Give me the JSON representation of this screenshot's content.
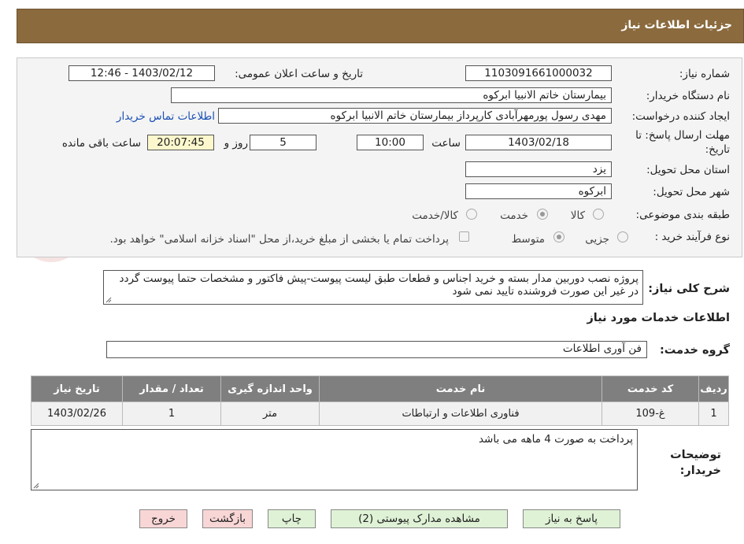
{
  "header": {
    "title": "جزئیات اطلاعات نیاز"
  },
  "form": {
    "need_number_label": "شماره نیاز:",
    "need_number": "1103091661000032",
    "announce_label": "تاریخ و ساعت اعلان عمومی:",
    "announce_value": "1403/02/12 - 12:46",
    "buyer_org_label": "نام دستگاه خریدار:",
    "buyer_org": "بیمارستان خاتم الانبیا ابرکوه",
    "creator_label": "ایجاد کننده درخواست:",
    "creator": "مهدی رسول پورمهرآبادی کارپرداز بیمارستان خاتم الانبیا ابرکوه",
    "contact_link": "اطلاعات تماس خریدار",
    "deadline_label": "مهلت ارسال پاسخ: تا تاریخ:",
    "deadline_date": "1403/02/18",
    "time_label": "ساعت",
    "deadline_time": "10:00",
    "days": "5",
    "days_label": "روز و",
    "remaining": "20:07:45",
    "remaining_label": "ساعت باقی مانده",
    "province_label": "استان محل تحویل:",
    "province": "یزد",
    "city_label": "شهر محل تحویل:",
    "city": "ابرکوه",
    "category_label": "طبقه بندی موضوعی:",
    "category_options": [
      "کالا",
      "خدمت",
      "کالا/خدمت"
    ],
    "category_selected": "خدمت",
    "process_label": "نوع فرآیند خرید :",
    "process_options": [
      "جزیی",
      "متوسط"
    ],
    "process_selected": "متوسط",
    "payment_note": "پرداخت تمام یا بخشی از مبلغ خرید،از محل \"اسناد خزانه اسلامی\" خواهد بود."
  },
  "description": {
    "label": "شرح کلی نیاز:",
    "text": "پروژه نصب دوربین مدار بسته و خرید اجناس و قطعات طبق لیست پیوست-پیش فاکتور و مشخصات حتما پیوست گردد در غیر این صورت فروشنده تایید نمی شود"
  },
  "services": {
    "section_title": "اطلاعات خدمات مورد نیاز",
    "group_label": "گروه خدمت:",
    "group_value": "فن آوری اطلاعات",
    "columns": [
      "ردیف",
      "کد خدمت",
      "نام خدمت",
      "واحد اندازه گیری",
      "تعداد / مقدار",
      "تاریخ نیاز"
    ],
    "rows": [
      [
        "1",
        "غ-109",
        "فناوری اطلاعات و ارتباطات",
        "متر",
        "1",
        "1403/02/26"
      ]
    ]
  },
  "buyer_notes": {
    "label": "توضیحات خریدار:",
    "text": "پرداخت به صورت 4 ماهه می باشد"
  },
  "buttons": {
    "reply": "پاسخ به نیاز",
    "attachments": "مشاهده مدارک پیوستی (2)",
    "print": "چاپ",
    "back": "بازگشت",
    "exit": "خروج"
  },
  "watermark": {
    "text": "AriaTender.neT"
  },
  "colors": {
    "header_bg": "#8b6a3e",
    "table_header_bg": "#7f7f7f",
    "button_green": "#dff2d6",
    "button_red": "#f9d6d6",
    "link": "#1a4fb5",
    "remaining_bg": "#fdf7cd"
  }
}
